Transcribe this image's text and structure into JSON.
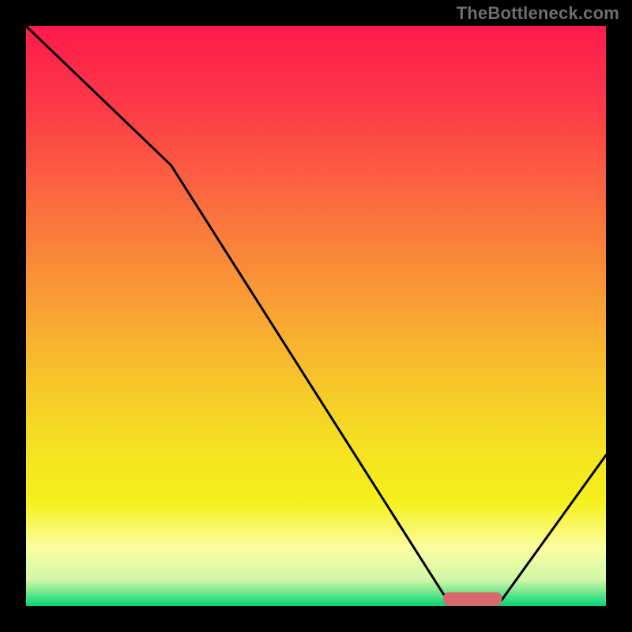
{
  "attribution": "TheBottleneck.com",
  "colors": {
    "frame": "#000000",
    "gradient_stops": [
      {
        "offset": 0.0,
        "color": "#fe1a4c"
      },
      {
        "offset": 0.14,
        "color": "#fd3a48"
      },
      {
        "offset": 0.3,
        "color": "#fb6b3f"
      },
      {
        "offset": 0.46,
        "color": "#f99a35"
      },
      {
        "offset": 0.6,
        "color": "#f7c22b"
      },
      {
        "offset": 0.72,
        "color": "#f5e022"
      },
      {
        "offset": 0.82,
        "color": "#f4f11c"
      },
      {
        "offset": 0.9,
        "color": "#fcfda1"
      },
      {
        "offset": 0.955,
        "color": "#d0f7a8"
      },
      {
        "offset": 0.975,
        "color": "#7ae88f"
      },
      {
        "offset": 1.0,
        "color": "#02d576"
      }
    ],
    "curve": "#000000",
    "marker_fill": "#d86a6d",
    "marker_stroke": "#d86a6d"
  },
  "chart_data": {
    "type": "line",
    "title": "",
    "xlabel": "",
    "ylabel": "",
    "xlim": [
      0,
      100
    ],
    "ylim": [
      0,
      100
    ],
    "series": [
      {
        "name": "bottleneck-curve",
        "x": [
          0,
          25,
          72,
          78,
          82,
          100
        ],
        "values": [
          100,
          76,
          2,
          1,
          1,
          26
        ]
      }
    ],
    "marker": {
      "name": "current-config",
      "x_range": [
        72,
        82
      ],
      "y": 1.2,
      "thickness": 2.2
    }
  }
}
